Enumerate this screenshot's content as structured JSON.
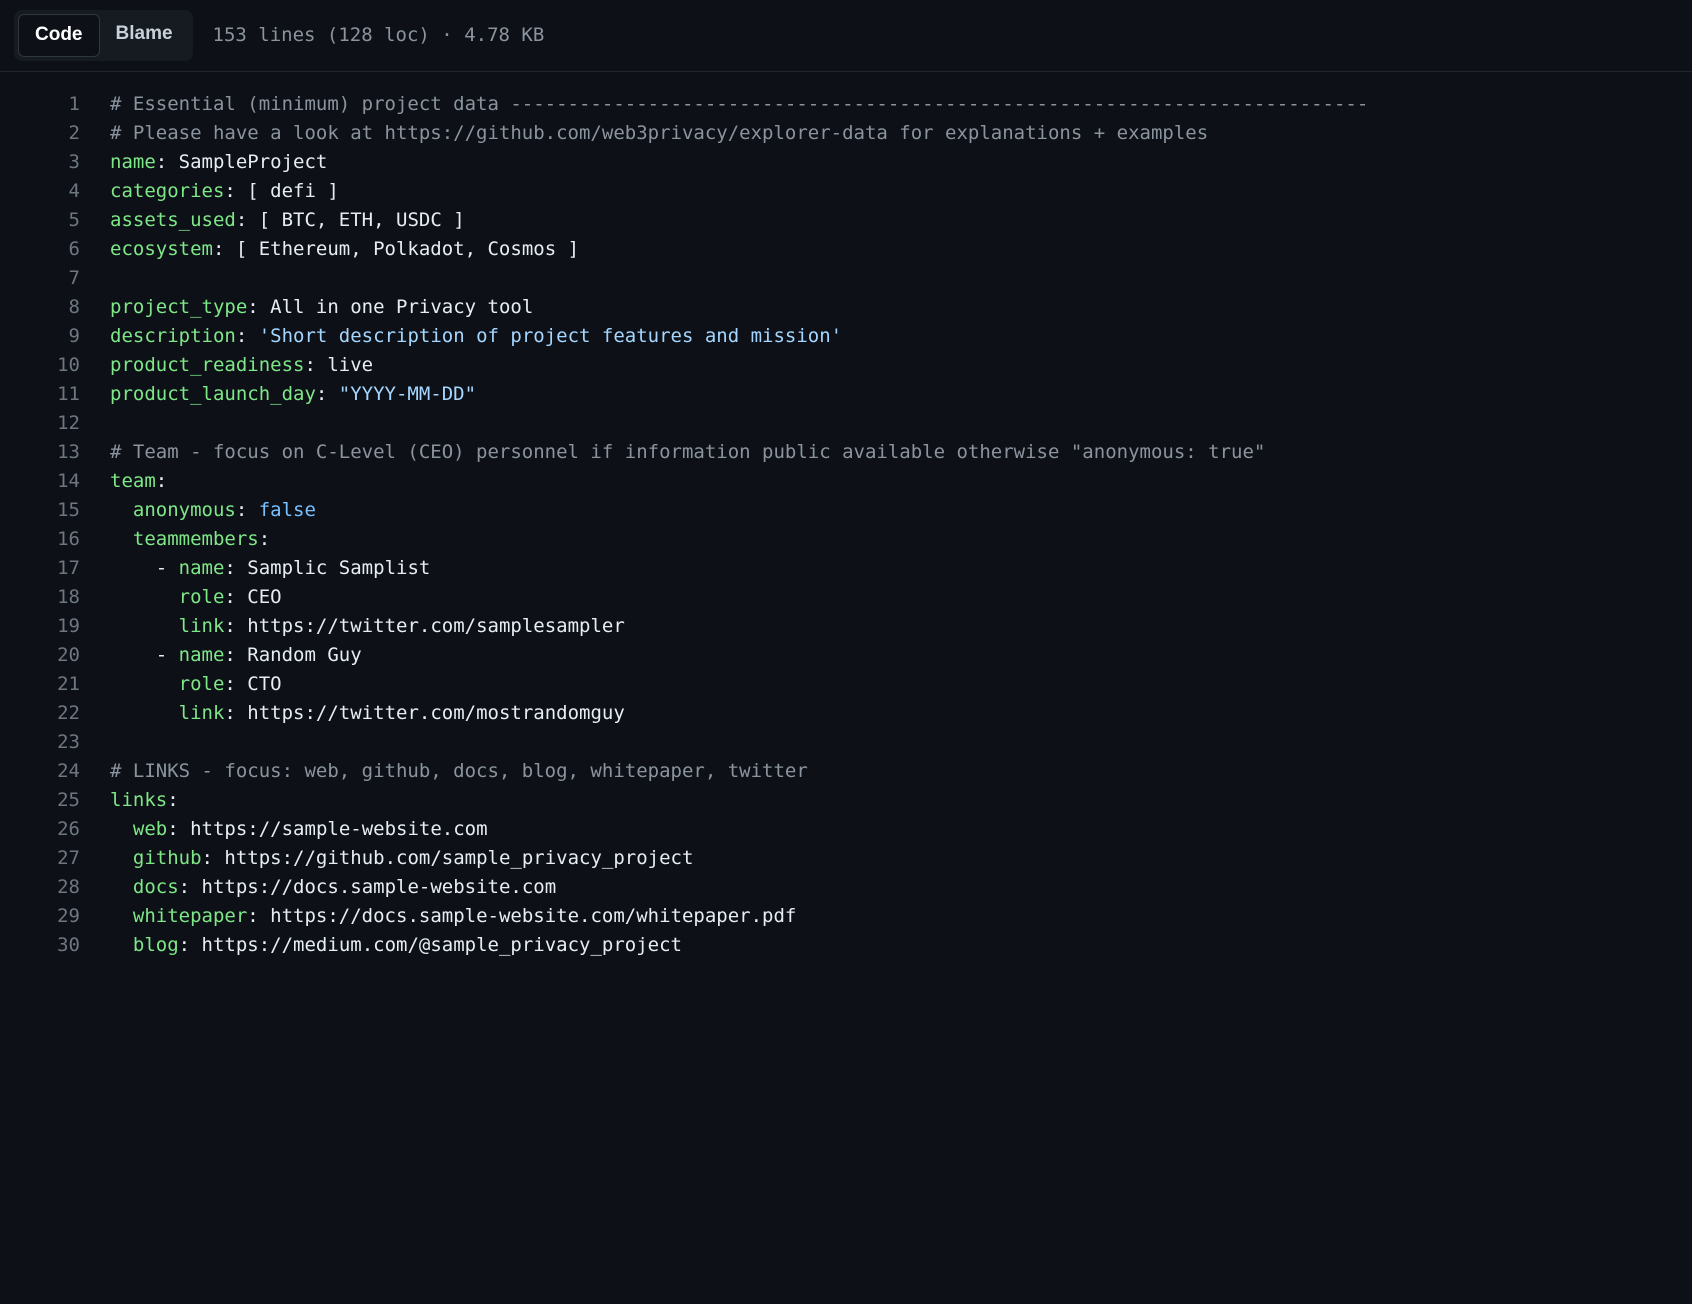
{
  "toolbar": {
    "code_label": "Code",
    "blame_label": "Blame",
    "meta": "153 lines (128 loc) · 4.78 KB"
  },
  "lines": [
    {
      "n": 1,
      "tokens": [
        [
          "comment",
          "# Essential (minimum) project data ---------------------------------------------------------------------------"
        ]
      ]
    },
    {
      "n": 2,
      "tokens": [
        [
          "comment",
          "# Please have a look at https://github.com/web3privacy/explorer-data for explanations + examples"
        ]
      ]
    },
    {
      "n": 3,
      "tokens": [
        [
          "key",
          "name"
        ],
        [
          "punc",
          ": "
        ],
        [
          "plain",
          "SampleProject"
        ]
      ]
    },
    {
      "n": 4,
      "tokens": [
        [
          "key",
          "categories"
        ],
        [
          "punc",
          ": [ "
        ],
        [
          "plain",
          "defi"
        ],
        [
          "punc",
          " ]"
        ]
      ]
    },
    {
      "n": 5,
      "tokens": [
        [
          "key",
          "assets_used"
        ],
        [
          "punc",
          ": [ "
        ],
        [
          "plain",
          "BTC, ETH, USDC"
        ],
        [
          "punc",
          " ]"
        ]
      ]
    },
    {
      "n": 6,
      "tokens": [
        [
          "key",
          "ecosystem"
        ],
        [
          "punc",
          ": [ "
        ],
        [
          "plain",
          "Ethereum, Polkadot, Cosmos"
        ],
        [
          "punc",
          " ]"
        ]
      ]
    },
    {
      "n": 7,
      "tokens": []
    },
    {
      "n": 8,
      "tokens": [
        [
          "key",
          "project_type"
        ],
        [
          "punc",
          ": "
        ],
        [
          "plain",
          "All in one Privacy tool"
        ]
      ]
    },
    {
      "n": 9,
      "tokens": [
        [
          "key",
          "description"
        ],
        [
          "punc",
          ": "
        ],
        [
          "string",
          "'Short description of project features and mission'"
        ]
      ]
    },
    {
      "n": 10,
      "tokens": [
        [
          "key",
          "product_readiness"
        ],
        [
          "punc",
          ": "
        ],
        [
          "plain",
          "live"
        ]
      ]
    },
    {
      "n": 11,
      "tokens": [
        [
          "key",
          "product_launch_day"
        ],
        [
          "punc",
          ": "
        ],
        [
          "string",
          "\"YYYY-MM-DD\""
        ]
      ]
    },
    {
      "n": 12,
      "tokens": []
    },
    {
      "n": 13,
      "tokens": [
        [
          "comment",
          "# Team - focus on C-Level (CEO) personnel if information public available otherwise \"anonymous: true\""
        ]
      ]
    },
    {
      "n": 14,
      "tokens": [
        [
          "key",
          "team"
        ],
        [
          "punc",
          ":"
        ]
      ]
    },
    {
      "n": 15,
      "tokens": [
        [
          "plain",
          "  "
        ],
        [
          "key",
          "anonymous"
        ],
        [
          "punc",
          ": "
        ],
        [
          "bool",
          "false"
        ]
      ]
    },
    {
      "n": 16,
      "tokens": [
        [
          "plain",
          "  "
        ],
        [
          "key",
          "teammembers"
        ],
        [
          "punc",
          ":"
        ]
      ]
    },
    {
      "n": 17,
      "tokens": [
        [
          "plain",
          "    - "
        ],
        [
          "key",
          "name"
        ],
        [
          "punc",
          ": "
        ],
        [
          "plain",
          "Samplic Samplist"
        ]
      ]
    },
    {
      "n": 18,
      "tokens": [
        [
          "plain",
          "      "
        ],
        [
          "key",
          "role"
        ],
        [
          "punc",
          ": "
        ],
        [
          "plain",
          "CEO"
        ]
      ]
    },
    {
      "n": 19,
      "tokens": [
        [
          "plain",
          "      "
        ],
        [
          "key",
          "link"
        ],
        [
          "punc",
          ": "
        ],
        [
          "plain",
          "https://twitter.com/samplesampler"
        ]
      ]
    },
    {
      "n": 20,
      "tokens": [
        [
          "plain",
          "    - "
        ],
        [
          "key",
          "name"
        ],
        [
          "punc",
          ": "
        ],
        [
          "plain",
          "Random Guy"
        ]
      ]
    },
    {
      "n": 21,
      "tokens": [
        [
          "plain",
          "      "
        ],
        [
          "key",
          "role"
        ],
        [
          "punc",
          ": "
        ],
        [
          "plain",
          "CTO"
        ]
      ]
    },
    {
      "n": 22,
      "tokens": [
        [
          "plain",
          "      "
        ],
        [
          "key",
          "link"
        ],
        [
          "punc",
          ": "
        ],
        [
          "plain",
          "https://twitter.com/mostrandomguy"
        ]
      ]
    },
    {
      "n": 23,
      "tokens": []
    },
    {
      "n": 24,
      "tokens": [
        [
          "comment",
          "# LINKS - focus: web, github, docs, blog, whitepaper, twitter"
        ]
      ]
    },
    {
      "n": 25,
      "tokens": [
        [
          "key",
          "links"
        ],
        [
          "punc",
          ":"
        ]
      ]
    },
    {
      "n": 26,
      "tokens": [
        [
          "plain",
          "  "
        ],
        [
          "key",
          "web"
        ],
        [
          "punc",
          ": "
        ],
        [
          "plain",
          "https://sample-website.com"
        ]
      ]
    },
    {
      "n": 27,
      "tokens": [
        [
          "plain",
          "  "
        ],
        [
          "key",
          "github"
        ],
        [
          "punc",
          ": "
        ],
        [
          "plain",
          "https://github.com/sample_privacy_project"
        ]
      ]
    },
    {
      "n": 28,
      "tokens": [
        [
          "plain",
          "  "
        ],
        [
          "key",
          "docs"
        ],
        [
          "punc",
          ": "
        ],
        [
          "plain",
          "https://docs.sample-website.com"
        ]
      ]
    },
    {
      "n": 29,
      "tokens": [
        [
          "plain",
          "  "
        ],
        [
          "key",
          "whitepaper"
        ],
        [
          "punc",
          ": "
        ],
        [
          "plain",
          "https://docs.sample-website.com/whitepaper.pdf"
        ]
      ]
    },
    {
      "n": 30,
      "tokens": [
        [
          "plain",
          "  "
        ],
        [
          "key",
          "blog"
        ],
        [
          "punc",
          ": "
        ],
        [
          "plain",
          "https://medium.com/@sample_privacy_project"
        ]
      ]
    }
  ]
}
